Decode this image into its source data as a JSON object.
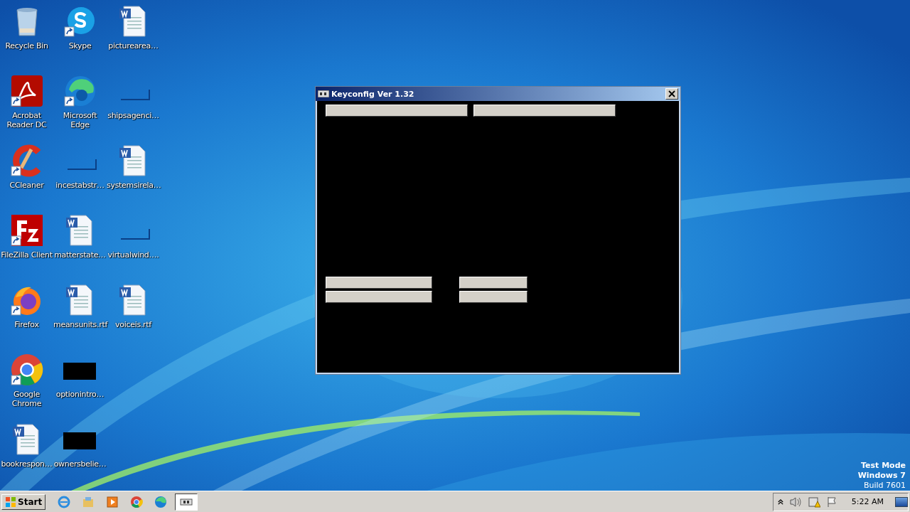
{
  "desktop_icons": [
    {
      "label": "Recycle Bin",
      "kind": "recycle",
      "shortcut": false
    },
    {
      "label": "Acrobat Reader DC",
      "kind": "acrobat",
      "shortcut": true
    },
    {
      "label": "CCleaner",
      "kind": "ccleaner",
      "shortcut": true
    },
    {
      "label": "FileZilla Client",
      "kind": "filezilla",
      "shortcut": true
    },
    {
      "label": "Firefox",
      "kind": "firefox",
      "shortcut": true
    },
    {
      "label": "Google Chrome",
      "kind": "chrome",
      "shortcut": true
    },
    {
      "label": "bookrespon…",
      "kind": "word",
      "shortcut": false
    },
    {
      "label": "Skype",
      "kind": "skype",
      "shortcut": true
    },
    {
      "label": "Microsoft Edge",
      "kind": "edge",
      "shortcut": true
    },
    {
      "label": "incestabstr…",
      "kind": "blank",
      "shortcut": false
    },
    {
      "label": "matterstate…",
      "kind": "word",
      "shortcut": false
    },
    {
      "label": "meansunits.rtf",
      "kind": "word",
      "shortcut": false
    },
    {
      "label": "optionintro…",
      "kind": "black",
      "shortcut": false
    },
    {
      "label": "ownersbelie…",
      "kind": "black",
      "shortcut": false
    },
    {
      "label": "picturearea…",
      "kind": "word",
      "shortcut": false
    },
    {
      "label": "shipsagenci…",
      "kind": "blank",
      "shortcut": false
    },
    {
      "label": "systemsirela…",
      "kind": "word",
      "shortcut": false
    },
    {
      "label": "virtualwind….",
      "kind": "blank",
      "shortcut": false
    },
    {
      "label": "voiceis.rtf",
      "kind": "word",
      "shortcut": false
    }
  ],
  "window": {
    "title": "Keyconfig Ver 1.32"
  },
  "watermark": [
    "Test Mode",
    "Windows 7",
    "Build 7601"
  ],
  "taskbar": {
    "start": "Start",
    "apps": [
      {
        "kind": "ie",
        "selected": false
      },
      {
        "kind": "explorer",
        "selected": false
      },
      {
        "kind": "media",
        "selected": false
      },
      {
        "kind": "chrome",
        "selected": false
      },
      {
        "kind": "edge",
        "selected": false
      },
      {
        "kind": "keyconfig",
        "selected": true
      }
    ],
    "clock": "5:22 AM"
  }
}
